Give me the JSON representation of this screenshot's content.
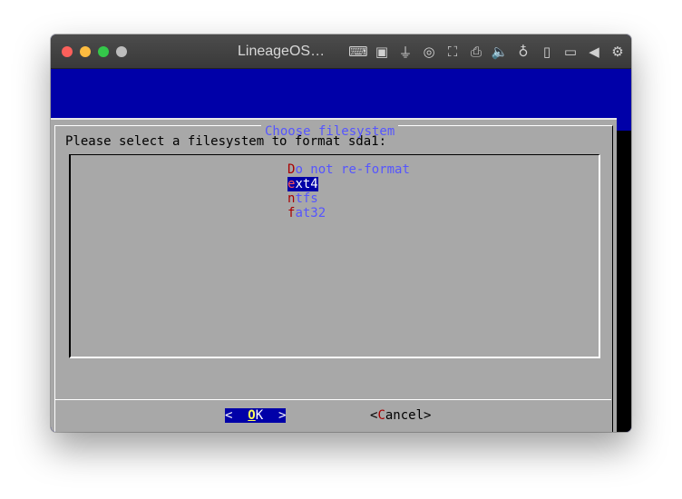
{
  "window": {
    "title": "LineageOS…",
    "toolbar_icons": [
      "keyboard-icon",
      "chip-icon",
      "usb-icon",
      "cd-icon",
      "network-icon",
      "save-icon",
      "speaker-icon",
      "microphone-icon",
      "phone-icon",
      "camera-icon",
      "back-icon",
      "gear-icon"
    ]
  },
  "dialog": {
    "title": "Choose filesystem",
    "prompt": "Please select a filesystem to format sda1:",
    "options": [
      {
        "hotkey": "D",
        "rest": "o not re-format",
        "selected": false
      },
      {
        "hotkey": "e",
        "rest": "xt4",
        "selected": true
      },
      {
        "hotkey": "n",
        "rest": "tfs",
        "selected": false
      },
      {
        "hotkey": "f",
        "rest": "at32",
        "selected": false
      }
    ],
    "ok": {
      "left": "<  ",
      "hotkey": "O",
      "rest": "K",
      "right": "  >"
    },
    "cancel": {
      "left": "<",
      "hotkey": "C",
      "rest": "ancel",
      "right": ">"
    }
  }
}
